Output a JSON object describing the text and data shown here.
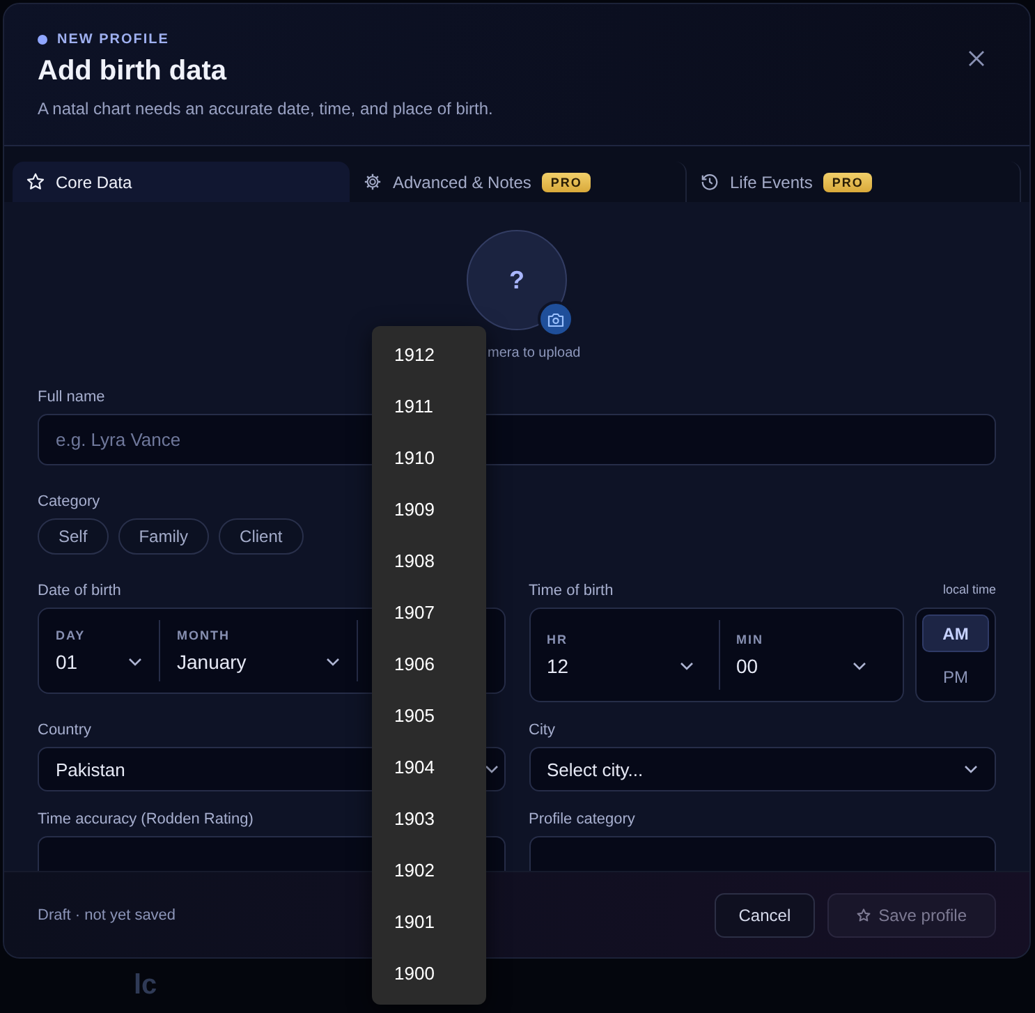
{
  "header": {
    "eyebrow": "NEW PROFILE",
    "title": "Add birth data",
    "subtitle": "A natal chart needs an accurate date, time, and place of birth."
  },
  "tabs": [
    {
      "label": "Core Data",
      "selected": true
    },
    {
      "label": "Advanced & Notes",
      "badge": "PRO",
      "selected": false
    },
    {
      "label": "Life Events",
      "badge": "PRO",
      "selected": false
    }
  ],
  "avatar": {
    "glyph": "?",
    "caption": "mera to upload"
  },
  "full_name": {
    "label": "Full name",
    "placeholder": "e.g. Lyra Vance"
  },
  "category": {
    "label": "Category",
    "options": [
      {
        "label": "Self",
        "selected": false
      },
      {
        "label": "Family",
        "selected": false
      },
      {
        "label": "Client",
        "selected": false
      }
    ]
  },
  "date_of_birth": {
    "label": "Date of birth",
    "parts": [
      {
        "label": "DAY",
        "value": "01"
      },
      {
        "label": "MONTH",
        "value": "January"
      }
    ]
  },
  "time_of_birth": {
    "label": "Time of birth",
    "note": "local time",
    "parts": [
      {
        "label": "HR",
        "value": "12"
      },
      {
        "label": "MIN",
        "value": "00"
      }
    ],
    "meridiem": [
      {
        "label": "AM",
        "selected": true
      },
      {
        "label": "PM",
        "selected": false
      }
    ]
  },
  "country": {
    "label": "Country",
    "value": "Pakistan"
  },
  "city": {
    "label": "City",
    "value": "Select city..."
  },
  "time_accuracy": {
    "label": "Time accuracy (Rodden Rating)"
  },
  "profile_category": {
    "label": "Profile category"
  },
  "footer": {
    "status": "Draft · not yet saved",
    "buttons": [
      {
        "label": "Cancel",
        "kind": "secondary",
        "disabled": false
      },
      {
        "label": "Save profile",
        "kind": "primary",
        "disabled": true
      }
    ]
  },
  "year_dropdown": {
    "options": [
      "1912",
      "1911",
      "1910",
      "1909",
      "1908",
      "1907",
      "1906",
      "1905",
      "1904",
      "1903",
      "1902",
      "1901",
      "1900"
    ]
  },
  "background_text": "lc"
}
